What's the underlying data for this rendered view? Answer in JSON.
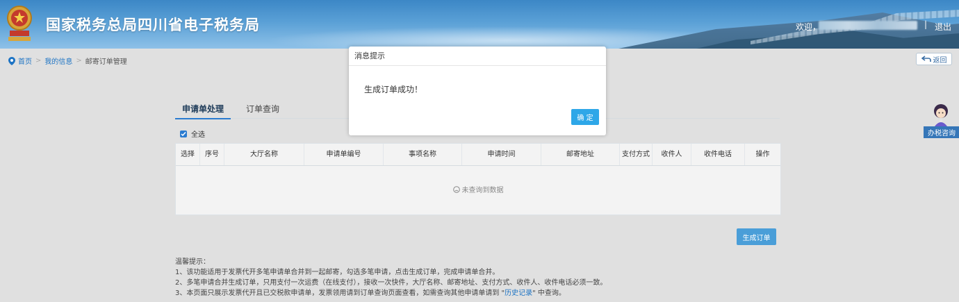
{
  "header": {
    "title": "国家税务总局四川省电子税务局",
    "welcome": "欢迎，",
    "separator": "|",
    "logout": "退出"
  },
  "breadcrumb": {
    "home": "首页",
    "my_info": "我的信息",
    "current": "邮寄订单管理",
    "sep": ">"
  },
  "back_button": "返回",
  "tabs": [
    {
      "label": "申请单处理",
      "active": true
    },
    {
      "label": "订单查询",
      "active": false
    }
  ],
  "select_all": "全选",
  "table": {
    "columns": [
      "选择",
      "序号",
      "大厅名称",
      "申请单编号",
      "事项名称",
      "申请时间",
      "邮寄地址",
      "支付方式",
      "收件人",
      "收件电话",
      "操作"
    ],
    "empty_text": "未查询到数据"
  },
  "generate_order_button": "生成订单",
  "tips": {
    "title": "温馨提示：",
    "line1": "1、该功能适用于发票代开多笔申请单合并到一起邮寄，勾选多笔申请，点击生成订单，完成申请单合并。",
    "line2": "2、多笔申请合并生成订单，只用支付一次运费（在线支付），接收一次快件，大厅名称、邮寄地址、支付方式、收件人、收件电话必须一致。",
    "line3_pre": "3、本页面只展示发票代开且已交税款申请单，发票领用请到订单查询页面查看，如需查询其他申请单请到 \"",
    "line3_link": "历史记录",
    "line3_post": "\" 中查询。"
  },
  "assistant_label": "办税咨询",
  "dialog": {
    "title": "消息提示",
    "message": "生成订单成功！",
    "ok": "确 定"
  },
  "colors": {
    "primary": "#2a7bd0",
    "dialog_button": "#2ea7e8",
    "header": "#3c87c6"
  }
}
